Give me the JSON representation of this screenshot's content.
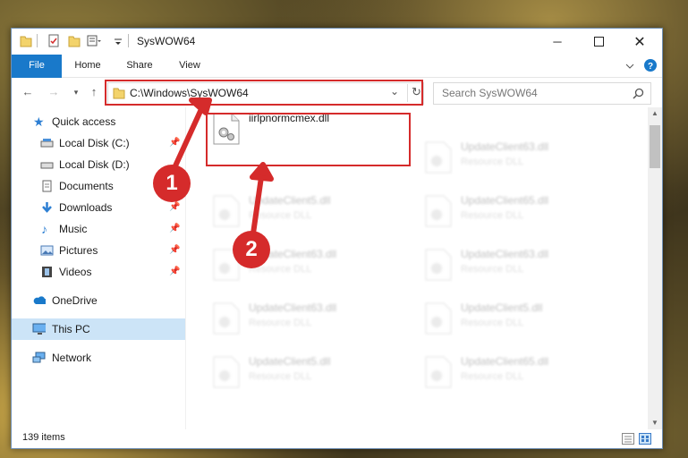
{
  "window": {
    "title": "SysWOW64",
    "minimize_icon": "minimize-icon",
    "maximize_icon": "maximize-icon",
    "close_icon": "close-icon"
  },
  "quick_access_toolbar": {
    "icons": [
      "folder-icon",
      "properties-icon",
      "new-folder-icon",
      "customize-icon"
    ]
  },
  "ribbon": {
    "tabs": [
      "File",
      "Home",
      "Share",
      "View"
    ],
    "accent_color": "#1979ca"
  },
  "address_bar": {
    "path": "C:\\Windows\\SysWOW64",
    "refresh_icon": "refresh-icon",
    "dropdown_icon": "chevron-down-icon"
  },
  "search": {
    "placeholder": "Search SysWOW64",
    "icon": "search-icon"
  },
  "sidebar": {
    "items": [
      {
        "label": "Quick access",
        "icon": "star-icon",
        "pinned": false
      },
      {
        "label": "Local Disk (C:)",
        "icon": "drive-icon",
        "pinned": true
      },
      {
        "label": "Local Disk (D:)",
        "icon": "drive-icon",
        "pinned": false
      },
      {
        "label": "Documents",
        "icon": "documents-icon",
        "pinned": true
      },
      {
        "label": "Downloads",
        "icon": "download-arrow-icon",
        "pinned": true
      },
      {
        "label": "Music",
        "icon": "music-note-icon",
        "pinned": true
      },
      {
        "label": "Pictures",
        "icon": "pictures-icon",
        "pinned": true
      },
      {
        "label": "Videos",
        "icon": "film-icon",
        "pinned": true
      },
      {
        "label": "OneDrive",
        "icon": "cloud-icon",
        "pinned": false
      },
      {
        "label": "This PC",
        "icon": "monitor-icon",
        "pinned": false,
        "selected": true
      },
      {
        "label": "Network",
        "icon": "network-icon",
        "pinned": false
      }
    ]
  },
  "files": [
    {
      "name": "iirlpnormcmex.dll",
      "type": ""
    },
    {
      "name": "UpdateClient63.dll",
      "type": "Resource DLL"
    },
    {
      "name": "UpdateClient5.dll",
      "type": "Resource DLL"
    },
    {
      "name": "UpdateClient65.dll",
      "type": "Resource DLL"
    },
    {
      "name": "UpdateClient63.dll",
      "type": "Resource DLL"
    },
    {
      "name": "UpdateClient63.dll",
      "type": "Resource DLL"
    },
    {
      "name": "UpdateClient63.dll",
      "type": "Resource DLL"
    },
    {
      "name": "UpdateClient5.dll",
      "type": "Resource DLL"
    },
    {
      "name": "UpdateClient5.dll",
      "type": "Resource DLL"
    },
    {
      "name": "UpdateClient65.dll",
      "type": "Resource DLL"
    }
  ],
  "status_bar": {
    "item_count": "139 items",
    "view_icons": [
      "details-view-icon",
      "large-icons-view-icon"
    ]
  },
  "annotations": {
    "step1": "1",
    "step2": "2",
    "highlight_color": "#d52b2b"
  }
}
